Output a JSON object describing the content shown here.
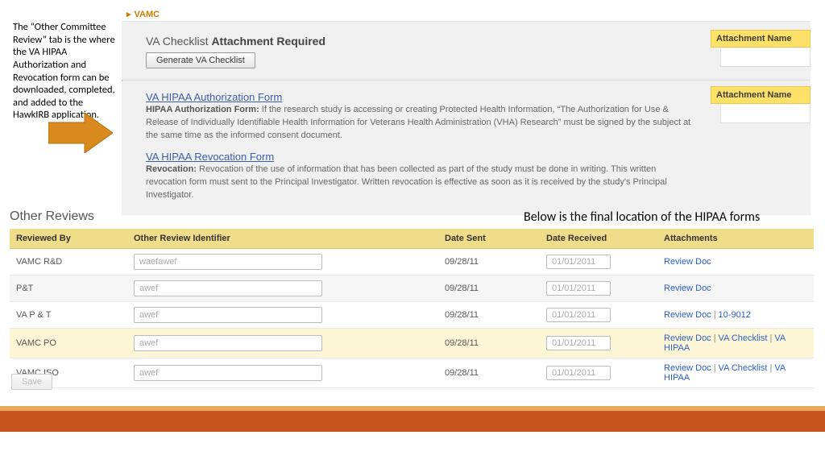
{
  "annotations": {
    "left_callout": "The “Other Committee Review” tab is  the where the VA HIPAA Authorization and Revocation form can be downloaded, completed, and added to the HawkIRB application.",
    "right_callout": "Below is the final location of the HIPAA forms"
  },
  "vamc_header": "VAMC",
  "va_checklist": {
    "title": "VA Checklist",
    "required_label": "Attachment Required",
    "button": "Generate VA Checklist",
    "attach_col": "Attachment Name"
  },
  "hipaa_auth": {
    "link": "VA HIPAA Authorization Form",
    "label": "HIPAA Authorization Form:",
    "text": " If the research study is accessing or creating Protected Health Information, “The Authorization for Use & Release of Individually Identifiable Health Information for Veterans Health Administration (VHA) Research” must be signed by the subject at the same time as the informed consent document.",
    "attach_col": "Attachment Name"
  },
  "hipaa_rev": {
    "link": "VA HIPAA Revocation Form",
    "label": "Revocation:",
    "text": " Revocation of the use of information that has been collected as part of the study must be done in writing. This written revocation form must sent to the Principal Investigator. Written revocation is effective as soon as it is received by the study's Principal Investigator."
  },
  "section_title": "Other Reviews",
  "columns": {
    "reviewed_by": "Reviewed By",
    "identifier": "Other Review Identifier",
    "date_sent": "Date Sent",
    "date_received": "Date Received",
    "attachments": "Attachments"
  },
  "rows": [
    {
      "by": "VAMC R&D",
      "ident": "waefawef",
      "sent": "09/28/11",
      "recv": "01/01/2011",
      "links": [
        "Review Doc"
      ],
      "cls": "alt0"
    },
    {
      "by": "P&T",
      "ident": "awef",
      "sent": "09/28/11",
      "recv": "01/01/2011",
      "links": [
        "Review Doc"
      ],
      "cls": "alt1"
    },
    {
      "by": "VA P & T",
      "ident": "awef",
      "sent": "09/28/11",
      "recv": "01/01/2011",
      "links": [
        "Review Doc",
        "10-9012"
      ],
      "cls": "alt0"
    },
    {
      "by": "VAMC PO",
      "ident": "awef",
      "sent": "09/28/11",
      "recv": "01/01/2011",
      "links": [
        "Review Doc",
        "VA Checklist",
        "VA HIPAA"
      ],
      "cls": "hi"
    },
    {
      "by": "VAMC ISO",
      "ident": "awef",
      "sent": "09/28/11",
      "recv": "01/01/2011",
      "links": [
        "Review Doc",
        "VA Checklist",
        "VA HIPAA"
      ],
      "cls": "alt0"
    }
  ],
  "save_label": "Save"
}
